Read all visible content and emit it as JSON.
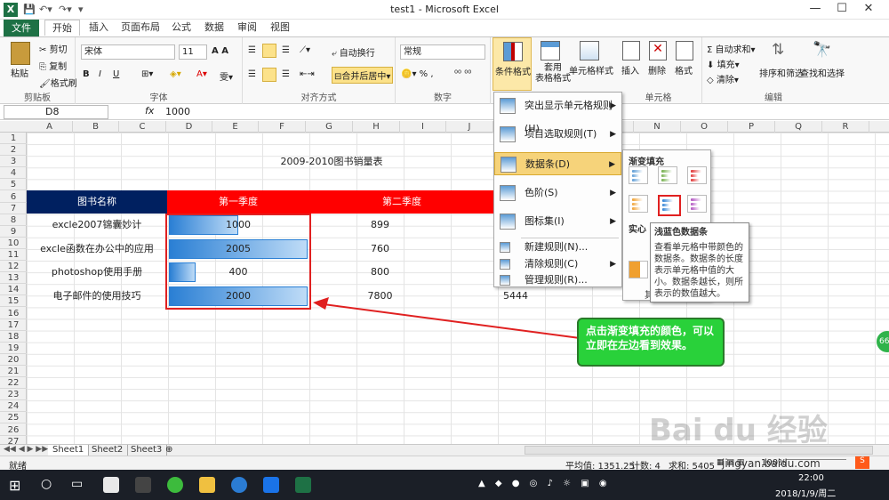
{
  "window": {
    "title": "test1 - Microsoft Excel",
    "app_icon": "X"
  },
  "ribbon_tabs": [
    "文件",
    "开始",
    "插入",
    "页面布局",
    "公式",
    "数据",
    "审阅",
    "视图"
  ],
  "ribbon": {
    "clipboard": {
      "paste": "粘贴",
      "cut": "剪切",
      "copy": "复制",
      "format_painter": "格式刷",
      "label": "剪贴板"
    },
    "font": {
      "name": "宋体",
      "size": "11",
      "label": "字体"
    },
    "alignment": {
      "wrap": "自动换行",
      "merge": "合并后居中",
      "label": "对齐方式"
    },
    "number": {
      "format": "常规",
      "label": "数字"
    },
    "styles": {
      "conditional": "条件格式",
      "table": "套用\n表格格式",
      "cell": "单元格样式"
    },
    "cells": {
      "insert": "插入",
      "delete": "删除",
      "format": "格式",
      "label": "单元格"
    },
    "editing": {
      "autosum": "自动求和",
      "fill": "填充",
      "clear": "清除",
      "sort": "排序和筛选",
      "find": "查找和选择",
      "label": "编辑"
    }
  },
  "formula_bar": {
    "name_box": "D8",
    "fx": "fx",
    "value": "1000"
  },
  "columns": [
    "A",
    "B",
    "C",
    "D",
    "E",
    "F",
    "G",
    "H",
    "I",
    "J",
    "K",
    "L",
    "M",
    "N",
    "O",
    "P",
    "Q",
    "R"
  ],
  "rows": [
    "1",
    "2",
    "3",
    "4",
    "5",
    "6",
    "7",
    "8",
    "9",
    "10",
    "11",
    "12",
    "13",
    "14",
    "15",
    "16",
    "17",
    "18",
    "19",
    "20",
    "21",
    "22",
    "23",
    "24",
    "25",
    "26",
    "27"
  ],
  "sheet": {
    "title": "2009-2010图书销量表",
    "header": {
      "book": "图书名称",
      "q1": "第一季度",
      "q2": "第二季度"
    },
    "records": [
      {
        "name": "excle2007锦囊妙计",
        "q1": "1000",
        "q1_fraction": 0.5,
        "q2": "899"
      },
      {
        "name": "excle函数在办公中的应用",
        "q1": "2005",
        "q1_fraction": 1.0,
        "q2": "760"
      },
      {
        "name": "photoshop使用手册",
        "q1": "400",
        "q1_fraction": 0.19,
        "q2": "800"
      },
      {
        "name": "电子邮件的使用技巧",
        "q1": "2000",
        "q1_fraction": 1.0,
        "q2": "7800",
        "q3": "5444"
      }
    ]
  },
  "cond_menu": {
    "items": [
      "突出显示单元格规则(H)",
      "项目选取规则(T)",
      "数据条(D)",
      "色阶(S)",
      "图标集(I)",
      "新建规则(N)...",
      "清除规则(C)",
      "管理规则(R)..."
    ]
  },
  "submenu": {
    "gradient_title": "渐变填充",
    "solid_title": "实心",
    "other_label": "其"
  },
  "tooltip": {
    "title": "浅蓝色数据条",
    "body": "查看单元格中带颜色的数据条。数据条的长度表示单元格中值的大小。数据条越长，则所表示的数值越大。"
  },
  "callout": {
    "text": "点击渐变填充的颜色，可以立即在左边看到效果。"
  },
  "sheet_tabs": [
    "Sheet1",
    "Sheet2",
    "Sheet3"
  ],
  "status": {
    "ready": "就绪",
    "average": "平均值: 1351.25",
    "count": "计数: 4",
    "sum": "求和: 5405",
    "zoom": "100%"
  },
  "taskbar": {
    "time": "22:00",
    "date": "2018/1/9/周二"
  },
  "watermark": {
    "text": "jingyan.baidu.com"
  },
  "side_badge": "66",
  "colors": {
    "accent": "#1e7145",
    "header_blue": "#002060",
    "header_red": "#ff0000",
    "callout_green": "#29d13a",
    "highlight_red": "#e02020"
  }
}
